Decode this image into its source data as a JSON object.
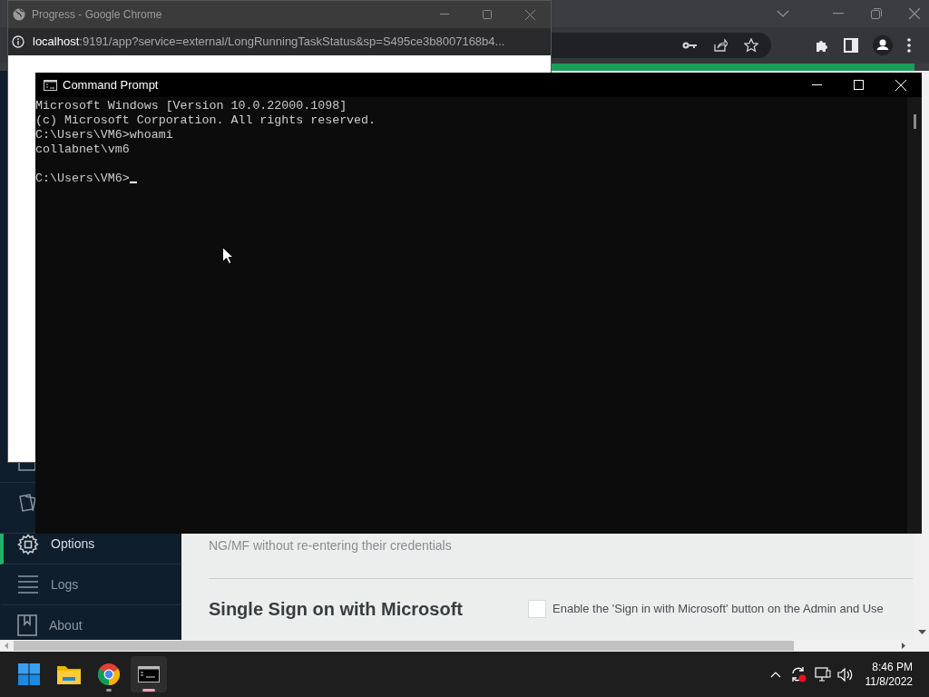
{
  "page": {
    "sidebar": {
      "items": [
        {
          "label": "Options",
          "selected": true
        },
        {
          "label": "Logs",
          "selected": false
        },
        {
          "label": "About",
          "selected": false
        }
      ]
    },
    "description": "NG/MF without re-entering their credentials",
    "section_title": "Single Sign on with Microsoft",
    "sso_checkbox": {
      "label": "Enable the 'Sign in with Microsoft' button on the Admin and Use",
      "checked": false
    }
  },
  "popup_window": {
    "title": "Progress - Google Chrome",
    "url_host": "localhost",
    "url_rest": ":9191/app?service=external/LongRunningTaskStatus&sp=S495ce3b8007168b4..."
  },
  "command_prompt": {
    "title": "Command Prompt",
    "lines": [
      "Microsoft Windows [Version 10.0.22000.1098]",
      "(c) Microsoft Corporation. All rights reserved.",
      "C:\\Users\\VM6>whoami",
      "collabnet\\vm6"
    ],
    "prompt": "C:\\Users\\VM6>"
  },
  "taskbar": {
    "apps": [
      {
        "kind": "start",
        "running": false,
        "selected": false
      },
      {
        "kind": "files",
        "running": false,
        "selected": false
      },
      {
        "kind": "chrome",
        "running": true,
        "selected": false
      },
      {
        "kind": "terminal",
        "running": true,
        "selected": true
      }
    ],
    "time": "8:46 PM",
    "date": "11/8/2022"
  }
}
